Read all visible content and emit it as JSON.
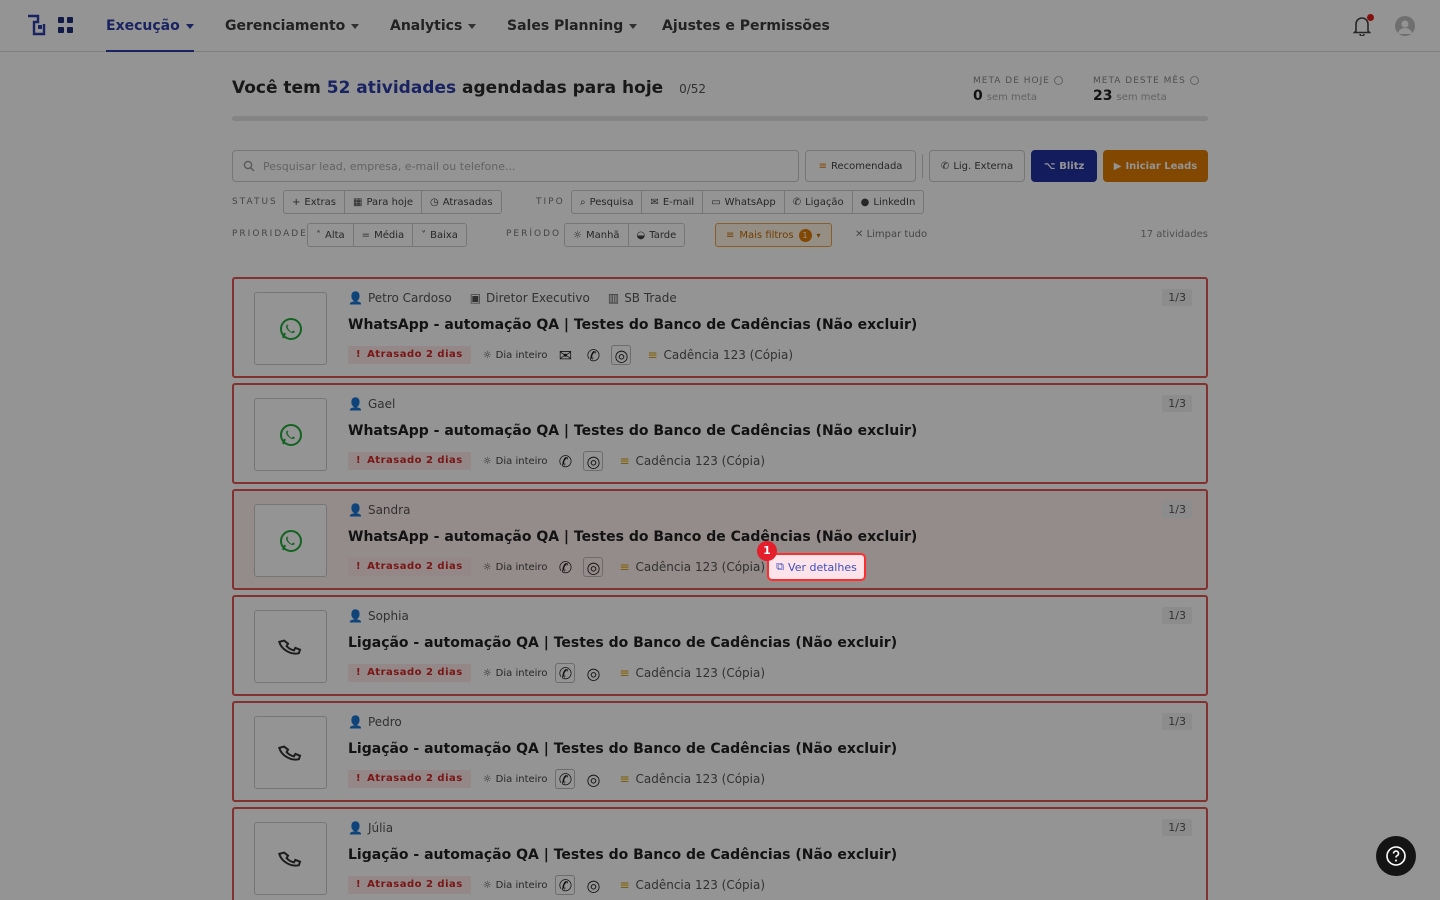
{
  "nav": {
    "items": [
      {
        "label": "Execução",
        "caret": true,
        "active": true
      },
      {
        "label": "Gerenciamento",
        "caret": true
      },
      {
        "label": "Analytics",
        "caret": true
      },
      {
        "label": "Sales Planning",
        "caret": true
      },
      {
        "label": "Ajustes e Permissões",
        "caret": false
      }
    ],
    "icons": [
      "logo-icon",
      "apps-grid-icon",
      "bell-icon",
      "user-avatar-icon"
    ]
  },
  "header": {
    "prefix": "Você tem",
    "highlight": "52 atividades",
    "suffix": "agendadas para hoje",
    "ratio": "0/52",
    "meta_hoje": {
      "label": "META DE HOJE",
      "value": "0",
      "note": "sem meta"
    },
    "meta_mes": {
      "label": "META DESTE MÊS",
      "value": "23",
      "note": "sem meta"
    }
  },
  "search": {
    "placeholder": "Pesquisar lead, empresa, e-mail ou telefone..."
  },
  "actions": {
    "recomendada": "Recomendada",
    "lig_externa": "Lig. Externa",
    "blitz": "Blitz",
    "iniciar": "Iniciar Leads"
  },
  "filters": {
    "status_label": "STATUS",
    "status": [
      "Extras",
      "Para hoje",
      "Atrasadas"
    ],
    "tipo_label": "TIPO",
    "tipo": [
      "Pesquisa",
      "E-mail",
      "WhatsApp",
      "Ligação",
      "LinkedIn"
    ],
    "prioridade_label": "PRIORIDADE",
    "prioridade": [
      "Alta",
      "Média",
      "Baixa"
    ],
    "periodo_label": "PERÍODO",
    "periodo": [
      "Manhã",
      "Tarde"
    ],
    "mais_filtros": "Mais filtros",
    "mais_filtros_count": "1",
    "limpar": "Limpar tudo",
    "count": "17 atividades"
  },
  "cards": [
    {
      "person": "Petro Cardoso",
      "role": "Diretor Executivo",
      "company": "SB Trade",
      "title": "WhatsApp - automação QA | Testes do Banco de Cadências (Não excluir)",
      "badge": "Atrasado 2 dias",
      "period": "Dia inteiro",
      "cadence": "Cadência 123 (Cópia)",
      "step": "1/3",
      "kind": "whatsapp",
      "email": true
    },
    {
      "person": "Gael",
      "title": "WhatsApp - automação QA | Testes do Banco de Cadências (Não excluir)",
      "badge": "Atrasado 2 dias",
      "period": "Dia inteiro",
      "cadence": "Cadência 123 (Cópia)",
      "step": "1/3",
      "kind": "whatsapp"
    },
    {
      "person": "Sandra",
      "title": "WhatsApp - automação QA | Testes do Banco de Cadências (Não excluir)",
      "badge": "Atrasado 2 dias",
      "period": "Dia inteiro",
      "cadence": "Cadência 123 (Cópia)",
      "step": "1/3",
      "kind": "whatsapp"
    },
    {
      "person": "Sophia",
      "title": "Ligação - automação QA | Testes do Banco de Cadências (Não excluir)",
      "badge": "Atrasado 2 dias",
      "period": "Dia inteiro",
      "cadence": "Cadência 123 (Cópia)",
      "step": "1/3",
      "kind": "phone"
    },
    {
      "person": "Pedro",
      "title": "Ligação - automação QA | Testes do Banco de Cadências (Não excluir)",
      "badge": "Atrasado 2 dias",
      "period": "Dia inteiro",
      "cadence": "Cadência 123 (Cópia)",
      "step": "1/3",
      "kind": "phone"
    },
    {
      "person": "Júlia",
      "title": "Ligação - automação QA | Testes do Banco de Cadências (Não excluir)",
      "badge": "Atrasado 2 dias",
      "period": "Dia inteiro",
      "cadence": "Cadência 123 (Cópia)",
      "step": "1/3",
      "kind": "phone"
    }
  ],
  "tooltip": {
    "label": "Ver detalhes",
    "marker": "1"
  },
  "colors": {
    "brand": "#2b3da8",
    "danger": "#e25353",
    "orange": "#e07b00",
    "whatsapp": "#1faa3a"
  }
}
